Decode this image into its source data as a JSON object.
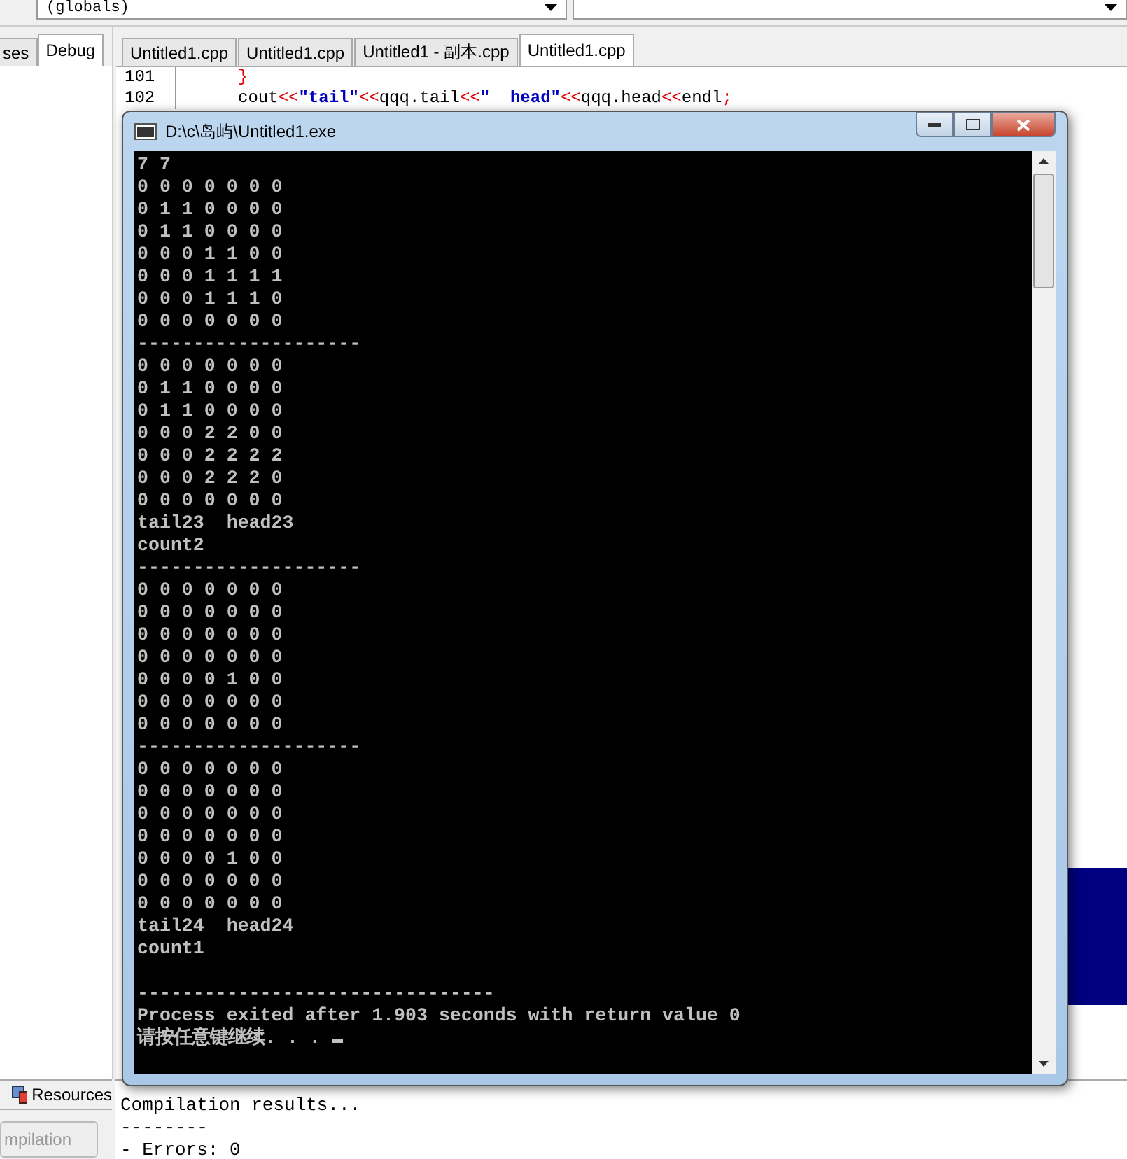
{
  "toolbar": {
    "dropdowns": [
      {
        "kind": "combo",
        "value": "(globals)"
      },
      {
        "kind": "combo"
      }
    ]
  },
  "left_panel": {
    "tabs": [
      {
        "label": "ses",
        "selected": false
      },
      {
        "label": "Debug",
        "selected": true
      }
    ]
  },
  "editor": {
    "tabs": [
      {
        "label": "Untitled1.cpp",
        "selected": false
      },
      {
        "label": "Untitled1.cpp",
        "selected": false
      },
      {
        "label": "Untitled1 - 副本.cpp",
        "selected": false
      },
      {
        "label": "Untitled1.cpp",
        "selected": true
      }
    ],
    "lines": [
      {
        "number": "101",
        "tokens": [
          {
            "kind": "brace",
            "text": "}"
          }
        ]
      },
      {
        "number": "102",
        "tokens": [
          {
            "kind": "plain",
            "text": "cout"
          },
          {
            "kind": "op",
            "text": "<<"
          },
          {
            "kind": "string",
            "text": "\"tail\""
          },
          {
            "kind": "op",
            "text": "<<"
          },
          {
            "kind": "plain",
            "text": "qqq.tail"
          },
          {
            "kind": "op",
            "text": "<<"
          },
          {
            "kind": "string",
            "text": "\"  head\""
          },
          {
            "kind": "op",
            "text": "<<"
          },
          {
            "kind": "plain",
            "text": "qqq.head"
          },
          {
            "kind": "op",
            "text": "<<"
          },
          {
            "kind": "plain",
            "text": "endl"
          },
          {
            "kind": "op",
            "text": ";"
          }
        ]
      }
    ]
  },
  "console": {
    "title": "D:\\c\\岛屿\\Untitled1.exe",
    "lines": [
      {
        "text": "7 7"
      },
      {
        "text": "0 0 0 0 0 0 0"
      },
      {
        "text": "0 1 1 0 0 0 0"
      },
      {
        "text": "0 1 1 0 0 0 0"
      },
      {
        "text": "0 0 0 1 1 0 0"
      },
      {
        "text": "0 0 0 1 1 1 1"
      },
      {
        "text": "0 0 0 1 1 1 0"
      },
      {
        "text": "0 0 0 0 0 0 0"
      },
      {
        "text": "--------------------"
      },
      {
        "text": "0 0 0 0 0 0 0"
      },
      {
        "text": "0 1 1 0 0 0 0"
      },
      {
        "text": "0 1 1 0 0 0 0"
      },
      {
        "text": "0 0 0 2 2 0 0"
      },
      {
        "text": "0 0 0 2 2 2 2"
      },
      {
        "text": "0 0 0 2 2 2 0"
      },
      {
        "text": "0 0 0 0 0 0 0"
      },
      {
        "text": "tail23  head23"
      },
      {
        "text": "count2"
      },
      {
        "text": "--------------------"
      },
      {
        "text": "0 0 0 0 0 0 0"
      },
      {
        "text": "0 0 0 0 0 0 0"
      },
      {
        "text": "0 0 0 0 0 0 0"
      },
      {
        "text": "0 0 0 0 0 0 0"
      },
      {
        "text": "0 0 0 0 1 0 0"
      },
      {
        "text": "0 0 0 0 0 0 0"
      },
      {
        "text": "0 0 0 0 0 0 0"
      },
      {
        "text": "--------------------"
      },
      {
        "text": "0 0 0 0 0 0 0"
      },
      {
        "text": "0 0 0 0 0 0 0"
      },
      {
        "text": "0 0 0 0 0 0 0"
      },
      {
        "text": "0 0 0 0 0 0 0"
      },
      {
        "text": "0 0 0 0 1 0 0"
      },
      {
        "text": "0 0 0 0 0 0 0"
      },
      {
        "text": "0 0 0 0 0 0 0"
      },
      {
        "text": "tail24  head24"
      },
      {
        "text": "count1"
      },
      {
        "text": "--------------------------------",
        "spaced": true
      },
      {
        "text": "Process exited after 1.903 seconds with return value 0"
      },
      {
        "text": "请按任意键继续. . . ",
        "cursor": true
      }
    ]
  },
  "bottom_panel": {
    "tab": "Resources",
    "button": "mpilation",
    "output": [
      "Compilation results...",
      "--------",
      "- Errors: 0"
    ]
  }
}
